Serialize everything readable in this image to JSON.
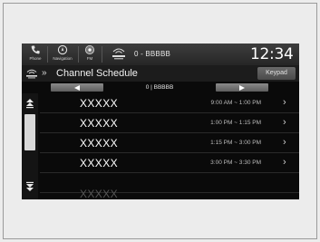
{
  "statusbar": {
    "phone_label": "Phone",
    "navigation_label": "Navigation",
    "fm_label": "FM",
    "station_text": "0 - BBBBB",
    "clock": "12:34"
  },
  "titlebar": {
    "title": "Channel Schedule",
    "keypad_label": "Keypad"
  },
  "nav": {
    "center_text": "0 | BBBBB"
  },
  "schedule": {
    "rows": [
      {
        "name": "XXXXX",
        "time": "9:00 AM ~ 1:00 PM"
      },
      {
        "name": "XXXXX",
        "time": "1:00 PM ~ 1:15 PM"
      },
      {
        "name": "XXXXX",
        "time": "1:15 PM ~ 3:00 PM"
      },
      {
        "name": "XXXXX",
        "time": "3:00 PM ~ 3:30 PM"
      },
      {
        "name": "XXXXX",
        "time": ""
      }
    ]
  },
  "colors": {
    "screen_bg": "#0a0a0a",
    "text": "#ffffff",
    "page_bg": "#ececec"
  }
}
